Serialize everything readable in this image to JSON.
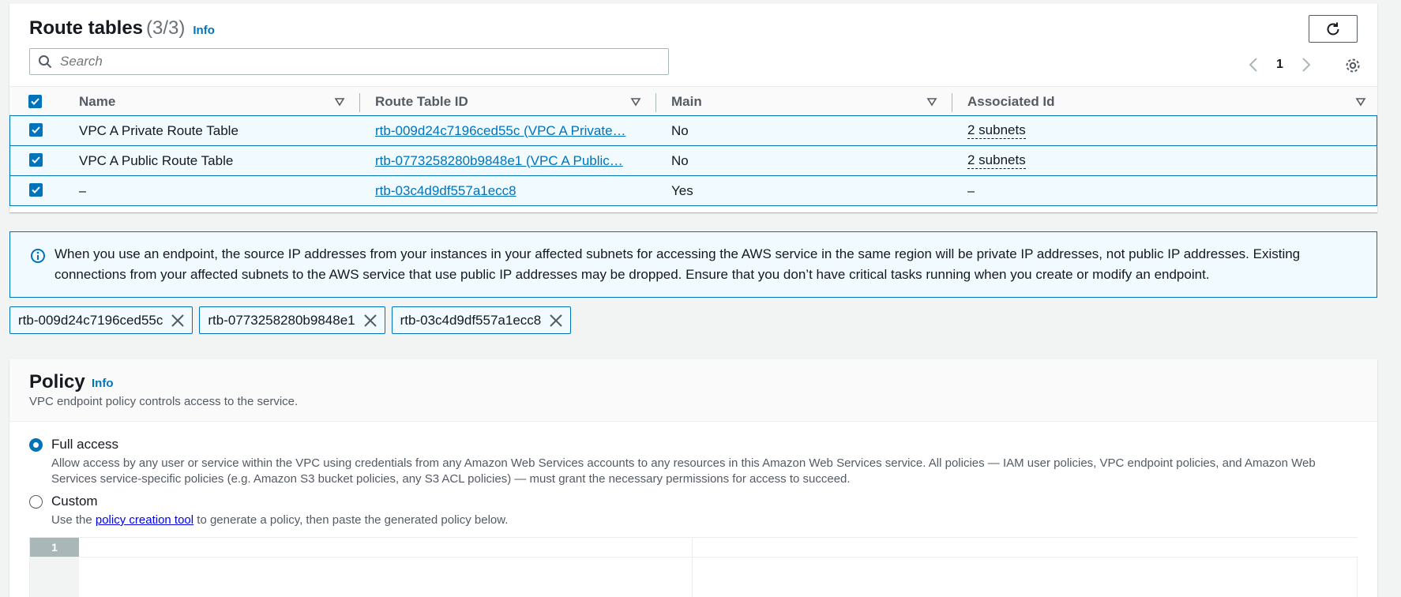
{
  "route_tables": {
    "title": "Route tables",
    "count": "(3/3)",
    "info": "Info",
    "search_placeholder": "Search",
    "page_number": "1",
    "columns": [
      "Name",
      "Route Table ID",
      "Main",
      "Associated Id"
    ],
    "rows": [
      {
        "name": "VPC A Private Route Table",
        "id": "rtb-009d24c7196ced55c (VPC A Private…",
        "main": "No",
        "assoc": "2 subnets"
      },
      {
        "name": "VPC A Public Route Table",
        "id": "rtb-0773258280b9848e1 (VPC A Public…",
        "main": "No",
        "assoc": "2 subnets"
      },
      {
        "name": "–",
        "id": "rtb-03c4d9df557a1ecc8",
        "main": "Yes",
        "assoc": "–"
      }
    ]
  },
  "alert": {
    "text": "When you use an endpoint, the source IP addresses from your instances in your affected subnets for accessing the AWS service in the same region will be private IP addresses, not public IP addresses. Existing connections from your affected subnets to the AWS service that use public IP addresses may be dropped. Ensure that you don’t have critical tasks running when you create or modify an endpoint."
  },
  "tokens": [
    "rtb-009d24c7196ced55c",
    "rtb-0773258280b9848e1",
    "rtb-03c4d9df557a1ecc8"
  ],
  "policy": {
    "title": "Policy",
    "info": "Info",
    "description": "VPC endpoint policy controls access to the service.",
    "full_access_label": "Full access",
    "full_access_desc": "Allow access by any user or service within the VPC using credentials from any Amazon Web Services accounts to any resources in this Amazon Web Services service. All policies — IAM user policies, VPC endpoint policies, and Amazon Web Services service-specific policies (e.g. Amazon S3 bucket policies, any S3 ACL policies) — must grant the necessary permissions for access to succeed.",
    "custom_label": "Custom",
    "custom_desc_prefix": "Use the",
    "custom_desc_link": "policy creation tool",
    "custom_desc_suffix": "to generate a policy, then paste the generated policy below.",
    "editor_line": "1"
  },
  "colors": {
    "accent": "#0073bb",
    "selected_bg": "#f1faff",
    "text": "#16191f",
    "muted": "#545b64"
  },
  "icons": [
    "refresh-icon",
    "search-icon",
    "chevron-left-icon",
    "chevron-right-icon",
    "gear-icon",
    "sort-down-icon",
    "check-icon",
    "info-circle-icon",
    "close-icon"
  ]
}
